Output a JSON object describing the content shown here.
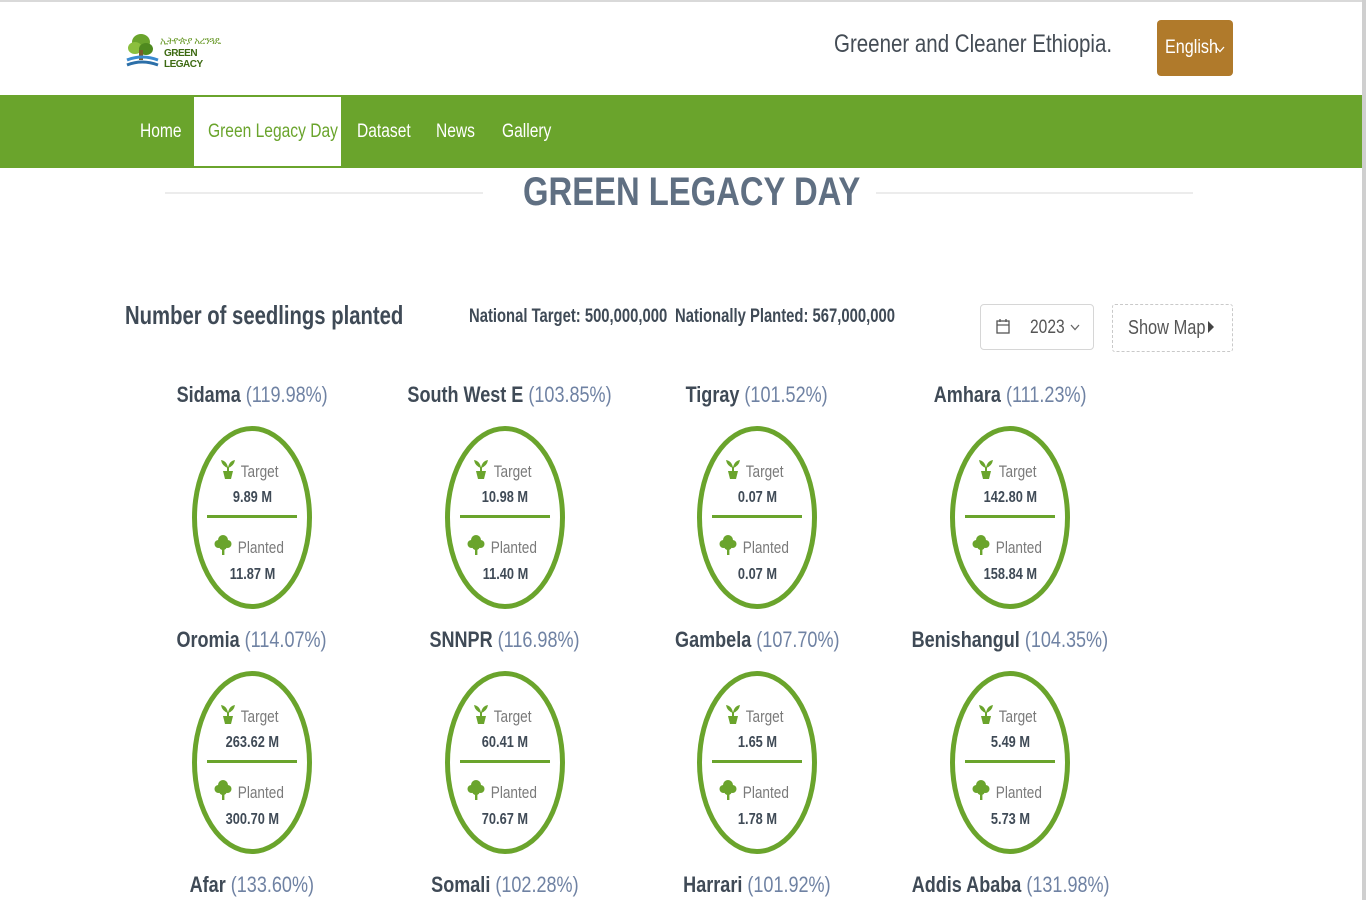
{
  "header": {
    "logo": {
      "line1": "ኢትዮጵያ አረንጓዴ",
      "line2": "GREEN LEGACY"
    },
    "tagline": "Greener and Cleaner Ethiopia.",
    "language": {
      "label": "English",
      "icon": "chevron-down-icon"
    }
  },
  "nav": {
    "items": [
      {
        "label": "Home",
        "active": false
      },
      {
        "label": "Green Legacy Day",
        "active": true
      },
      {
        "label": "Dataset",
        "active": false
      },
      {
        "label": "News",
        "active": false
      },
      {
        "label": "Gallery",
        "active": false
      }
    ]
  },
  "page": {
    "title": "GREEN LEGACY DAY"
  },
  "summary": {
    "heading": "Number of seedlings planted",
    "national_target": "National Target: 500,000,000",
    "nationally_planted": "Nationally Planted: 567,000,000",
    "year": "2023",
    "show_map": "Show Map"
  },
  "card_labels": {
    "target": "Target",
    "planted": "Planted"
  },
  "colors": {
    "brand_green": "#6aa42c",
    "accent_brown": "#b07a2b",
    "percent_blue": "#6f82a3"
  },
  "regions": [
    {
      "name": "Sidama",
      "percent": "(119.98%)",
      "target": "9.89 M",
      "planted": "11.87 M"
    },
    {
      "name": "South West E",
      "percent": "(103.85%)",
      "target": "10.98 M",
      "planted": "11.40 M"
    },
    {
      "name": "Tigray",
      "percent": "(101.52%)",
      "target": "0.07 M",
      "planted": "0.07 M"
    },
    {
      "name": "Amhara",
      "percent": "(111.23%)",
      "target": "142.80 M",
      "planted": "158.84 M"
    },
    {
      "name": "Oromia",
      "percent": "(114.07%)",
      "target": "263.62 M",
      "planted": "300.70 M"
    },
    {
      "name": "SNNPR",
      "percent": "(116.98%)",
      "target": "60.41 M",
      "planted": "70.67 M"
    },
    {
      "name": "Gambela",
      "percent": "(107.70%)",
      "target": "1.65 M",
      "planted": "1.78 M"
    },
    {
      "name": "Benishangul",
      "percent": "(104.35%)",
      "target": "5.49 M",
      "planted": "5.73 M"
    },
    {
      "name": "Afar",
      "percent": "(133.60%)"
    },
    {
      "name": "Somali",
      "percent": "(102.28%)"
    },
    {
      "name": "Harrari",
      "percent": "(101.92%)"
    },
    {
      "name": "Addis Ababa",
      "percent": "(131.98%)"
    }
  ]
}
